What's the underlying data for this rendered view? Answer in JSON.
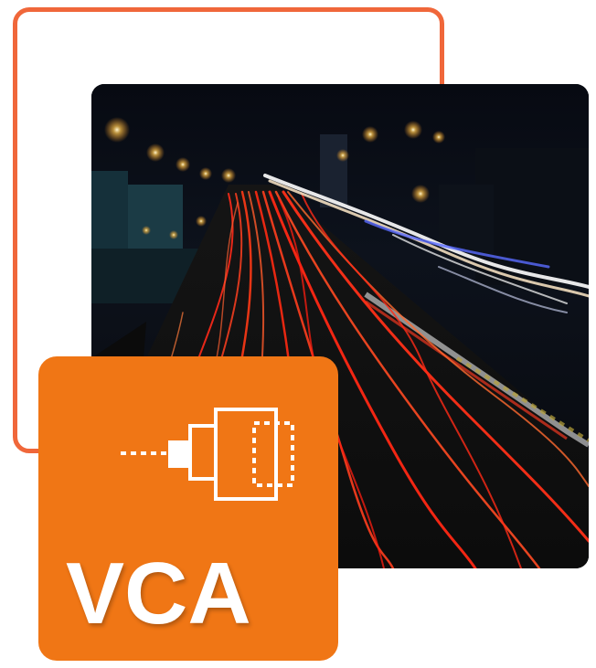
{
  "badge": {
    "label": "VCA",
    "icon": "video-content-analytics-icon"
  },
  "image": {
    "subject": "night-highway-light-trails"
  },
  "colors": {
    "frame_accent": "#f0673a",
    "card_background": "#f07615",
    "label_color": "#ffffff"
  }
}
